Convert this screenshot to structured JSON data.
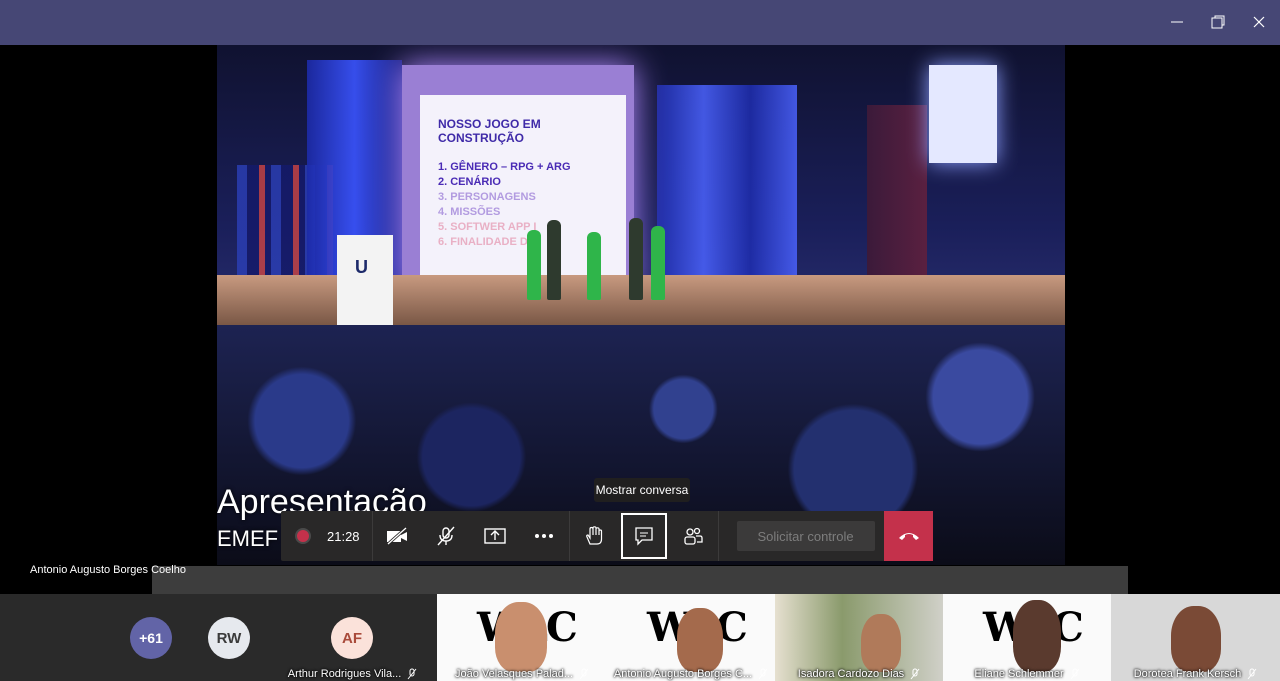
{
  "window": {
    "controls": [
      "minimize",
      "restore",
      "close"
    ]
  },
  "shared_content": {
    "slide_title": "NOSSO JOGO EM CONSTRUÇÃO",
    "slide_items": [
      "1. GÊNERO – RPG + ARG",
      "2. CENÁRIO",
      "3. PERSONAGENS",
      "4. MISSÕES",
      "5. SOFTWER APP I",
      "6. FINALIDADE DO"
    ],
    "podium_logo": "U",
    "caption_line1": "Apresentação",
    "caption_line2": "EMEF"
  },
  "tooltip": "Mostrar conversa",
  "toolbar": {
    "timer": "21:28",
    "request_control_label": "Solicitar controle",
    "buttons": [
      "camera-off",
      "mic-off",
      "share",
      "more",
      "raise-hand",
      "chat",
      "participants",
      "hang-up"
    ]
  },
  "presenter_name": "Antonio Augusto Borges Coelho",
  "participants_strip": {
    "overflow_count": "+61",
    "avatars": [
      {
        "initials": "RW",
        "color": "#e6e9ee",
        "text_color": "#3b3b3b"
      },
      {
        "initials": "AF",
        "color": "#fbe2da",
        "text_color": "#a94a3a"
      }
    ],
    "overflow_color": "#6264a7",
    "avatar_name": "Arthur Rodrigues Vila...",
    "tiles": [
      {
        "name": "João Velasques Palad...",
        "muted": true
      },
      {
        "name": "Antonio Augusto Borges C...",
        "muted": true
      },
      {
        "name": "Isadora Cardozo Dias",
        "muted": true
      },
      {
        "name": "Eliane Schlemmer",
        "muted": true
      },
      {
        "name": "Dorotea Frank Kersch",
        "muted": true
      }
    ],
    "tile_logo": "WLC"
  },
  "colors": {
    "titlebar": "#464775",
    "hangup": "#c4314b",
    "toolbar": "#292828"
  }
}
